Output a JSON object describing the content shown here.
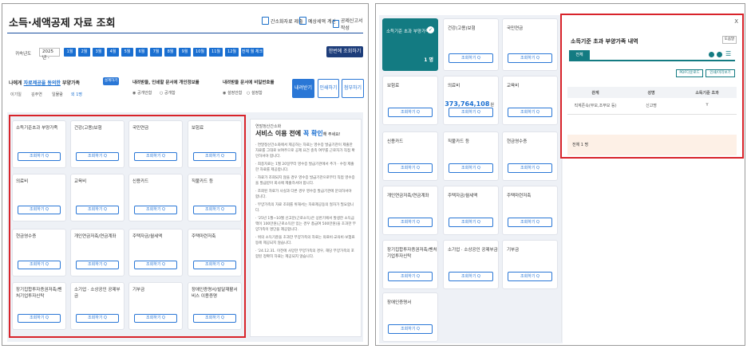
{
  "left": {
    "title": "소득·세액공제 자료 조회",
    "header_links": [
      "간소화자료 제출",
      "예상세액 계산",
      "공제신고서 작성"
    ],
    "year_label": "귀속년도",
    "year_value": "2025년 -",
    "months": [
      "1월",
      "2월",
      "3월",
      "4월",
      "5월",
      "6월",
      "7월",
      "8월",
      "9월",
      "10월",
      "11월",
      "12월",
      "전체 월 체크"
    ],
    "search_button": "한번에 조회하기",
    "dependent_title_prefix": "나에게 ",
    "dependent_title_link": "자료제공을 동의한",
    "dependent_title_suffix": " 부양가족",
    "dependent_button": "설계하기",
    "dependents": [
      "이기일",
      "김주연",
      "일뮬람",
      "외 1명"
    ],
    "print_title": "내려받을, 인쇄할 문서에 개인정보를",
    "print_options": [
      "공개안함",
      "공개함"
    ],
    "pw_title": "내려받을 문서에 비밀번호를",
    "pw_options": [
      "설정안함",
      "설정함"
    ],
    "download_buttons": [
      "내려받기",
      "인쇄하기",
      "첨부하기"
    ],
    "cards": [
      {
        "label": "소득기준초과 부양가족",
        "btn": "조회하기 Q"
      },
      {
        "label": "건강(고용)보험",
        "btn": "조회하기 Q"
      },
      {
        "label": "국민연금",
        "btn": "조회하기 Q"
      },
      {
        "label": "보험료",
        "btn": "조회하기 Q"
      },
      {
        "label": "의료비",
        "btn": "조회하기 Q"
      },
      {
        "label": "교육비",
        "btn": "조회하기 Q"
      },
      {
        "label": "신용카드",
        "btn": "조회하기 Q"
      },
      {
        "label": "직불카드 등",
        "btn": "조회하기 Q"
      },
      {
        "label": "현금영수증",
        "btn": "조회하기 Q"
      },
      {
        "label": "개인연금저축/연금계좌",
        "btn": "조회하기 Q"
      },
      {
        "label": "주택자금/월세액",
        "btn": "조회하기 Q"
      },
      {
        "label": "주택마련저축",
        "btn": "조회하기 Q"
      },
      {
        "label": "장기집합투자증권저축/벤처기업투자신탁",
        "btn": "조회하기 Q"
      },
      {
        "label": "소기업 · 소상공인 공제부금",
        "btn": "조회하기 Q"
      },
      {
        "label": "기부금",
        "btn": "조회하기 Q"
      },
      {
        "label": "장애인증명서/발달재활서비스 이용증명",
        "btn": "조회하기 Q"
      }
    ],
    "notice_small": "연말정산간소화",
    "notice_title_a": "서비스 이용 전에 ",
    "notice_title_b": "꼭 확인",
    "notice_title_c": "해 주세요!",
    "notice_lines": [
      "· 연말정산간소화에서 제공하는 자료는 영수증 발급기관이 제출한 자료를 그대로 보여주므로 공제 요건 충족 여부를 근로자가 직접 확인하셔야 합니다.",
      "· 최종자료는 1월 20일부터 영수증 발급기관에서 추가 · 수정 제출한 자료를 제공합니다.",
      "· 자료가 조회되지 않을 경우 영수증 발급기관으로부터 직접 영수증을 발급받아 회사에 제출하셔야 합니다.",
      "· 조회된 자료가 사실과 다른 경우 영수증 발급기관에 문의하셔야 합니다.",
      "· 부양가족의 자료 조회를 위해서는 자료제공동의 절차가 필요합니다.",
      "· '25년 1월~10월 신고분(근로소득)은 상반기에서 발생한 소득금액이 100만원(근로소득만 있는 경우 총급여 500만원)을 초과한 부양가족이 명단을 제공합니다.",
      "· 위의 소득기준을 초과한 부양가족의 자료는 의료비·교육비·보험료 등에 제공되지 않습니다.",
      "· '24.12.31. 이전에 사망한 부양가족의 경우, 해당 부양가족의 포함된 정확히 자료는 제공되지 않습니다."
    ]
  },
  "right": {
    "cards": [
      {
        "label": "소득기준 초과 부양가족",
        "count": "1 명",
        "btn": ""
      },
      {
        "label": "건강(고용)보험",
        "btn": "조회하기 Q"
      },
      {
        "label": "국민연금",
        "btn": "조회하기 Q"
      },
      {
        "label": "보험료",
        "btn": "조회하기 Q"
      },
      {
        "label": "의료비",
        "amount": "373,764,108",
        "unit": "원",
        "btn": "조회하기 Q"
      },
      {
        "label": "교육비",
        "btn": "조회하기 Q"
      },
      {
        "label": "신용카드",
        "btn": "조회하기 Q"
      },
      {
        "label": "직불카드 등",
        "btn": "조회하기 Q"
      },
      {
        "label": "현금영수증",
        "btn": "조회하기 Q"
      },
      {
        "label": "개인연금저축/연금계좌",
        "btn": "조회하기 Q"
      },
      {
        "label": "주택자금/월세액",
        "btn": "조회하기 Q"
      },
      {
        "label": "주택마련저축",
        "btn": "조회하기 Q"
      },
      {
        "label": "장기집합투자증권저축/벤처기업투자신탁",
        "btn": "조회하기 Q"
      },
      {
        "label": "소기업 · 소상공인 공제부금",
        "btn": "조회하기 Q"
      },
      {
        "label": "기부금",
        "btn": "조회하기 Q"
      },
      {
        "label": "장애인증명서",
        "btn": "조회하기 Q"
      }
    ],
    "modal": {
      "title": "소득기준 초과 부양가족 내역",
      "help_btn": "도움말",
      "tab": "전체",
      "btn_pdf": "PDF다운로드",
      "btn_print": "인쇄/미리보기",
      "columns": [
        "관계",
        "성명",
        "소득기준 초과"
      ],
      "row": [
        "직계존속(부모,조부모 등)",
        "신고명",
        "Y"
      ],
      "total": "전체 1 명",
      "close": "X"
    }
  }
}
